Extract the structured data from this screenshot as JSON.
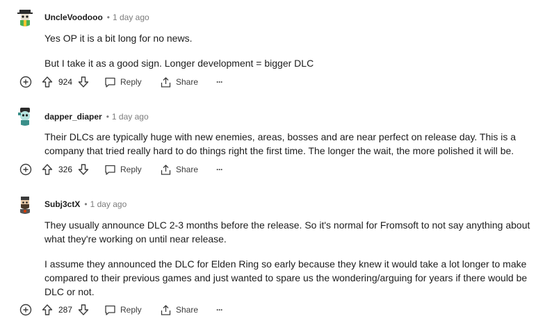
{
  "colors": {
    "text": "#1c1c1c",
    "meta": "#7c7c7c",
    "action": "#3c3c3c"
  },
  "actions": {
    "reply_label": "Reply",
    "share_label": "Share",
    "more_label": "···"
  },
  "comments": [
    {
      "username": "UncleVoodooo",
      "time": "1 day ago",
      "paragraphs": [
        "Yes OP it is a bit long for no news.",
        "But I take it as a good sign. Longer development = bigger DLC"
      ],
      "score": "924",
      "avatar": "green-hat-avatar-icon"
    },
    {
      "username": "dapper_diaper",
      "time": "1 day ago",
      "paragraphs": [
        "Their DLCs are typically huge with new enemies, areas, bosses and are near perfect on release day. This is a company that tried really hard to do things right the first time. The longer the wait, the more polished it will be."
      ],
      "score": "326",
      "avatar": "teal-avatar-icon"
    },
    {
      "username": "Subj3ctX",
      "time": "1 day ago",
      "paragraphs": [
        "They usually announce DLC 2-3 months before the release. So it's normal for Fromsoft to not say anything about what they're working on until near release.",
        "I assume they announced the DLC for Elden Ring so early because they knew it would take a lot longer to make compared to their previous games and just wanted to spare us the wondering/arguing for years if there would be DLC or not."
      ],
      "score": "287",
      "avatar": "bearded-avatar-icon"
    }
  ]
}
